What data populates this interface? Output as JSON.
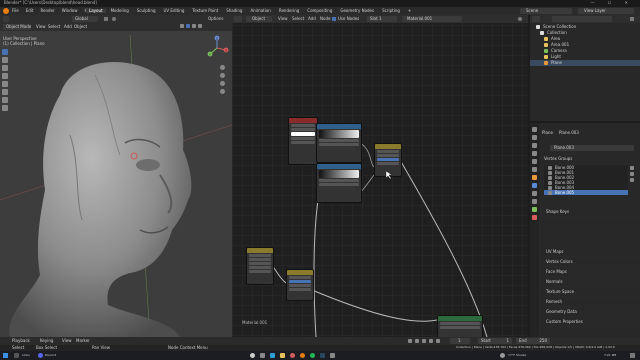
{
  "titlebar": {
    "title": "Blender* [C:\\Users\\Desktop\\blend\\head.blend]",
    "controls": [
      "—",
      "☐",
      "✕"
    ]
  },
  "menu": [
    "File",
    "Edit",
    "Render",
    "Window",
    "Help"
  ],
  "workspaces": [
    "Layout",
    "Modeling",
    "Sculpting",
    "UV Editing",
    "Texture Paint",
    "Shading",
    "Animation",
    "Rendering",
    "Compositing",
    "Geometry Nodes",
    "Scripting",
    "+"
  ],
  "active_workspace": "Layout",
  "scene": {
    "label": "Scene",
    "view_layer": "View Layer"
  },
  "viewport": {
    "transform": "Global",
    "options": "Options",
    "mode": "Object Mode",
    "menus": [
      "View",
      "Select",
      "Add",
      "Object"
    ],
    "info_line1": "User Perspective",
    "info_line2": "(1) Collection | Plane",
    "axes": [
      "Z",
      "X",
      "Y"
    ]
  },
  "node_editor": {
    "type": "Object",
    "menus": [
      "View",
      "Select",
      "Add",
      "Node"
    ],
    "use_nodes": "Use Nodes",
    "slot": "Slot 1",
    "material": "Material.001",
    "footer_label": "Material.001"
  },
  "outliner": {
    "title": "Scene Collection",
    "items": [
      {
        "name": "Collection",
        "icon": "collection-icon"
      },
      {
        "name": "Area",
        "icon": "light-icon"
      },
      {
        "name": "Area.001",
        "icon": "light-icon"
      },
      {
        "name": "Camera",
        "icon": "camera-icon"
      },
      {
        "name": "Light",
        "icon": "light-icon"
      },
      {
        "name": "Plane",
        "icon": "mesh-icon"
      }
    ]
  },
  "properties": {
    "object": "Plane",
    "data_name": "Plane.003",
    "mesh_field": "Plane.003",
    "vertex_groups_title": "Vertex Groups",
    "vertex_groups": [
      "Bone.000",
      "Bone.001",
      "Bone.002",
      "Bone.003",
      "Bone.004",
      "Bone.005"
    ],
    "shape_keys": "Shape Keys",
    "sections": [
      "UV Maps",
      "Vertex Colors",
      "Face Maps",
      "Normals",
      "Texture Space",
      "Remesh",
      "Geometry Data",
      "Custom Properties"
    ]
  },
  "timeline": {
    "menus": [
      "Playback",
      "Keying",
      "View",
      "Marker"
    ],
    "frame": "1",
    "start_label": "Start",
    "start": "1",
    "end_label": "End",
    "end": "250"
  },
  "statusbar": {
    "left": [
      "Select",
      "Box Select",
      "Pan View",
      "Node Context Menu"
    ],
    "right": "Collection | Plane | Verts:478,764 | Faces:478,464 | Tris:956,928 | Objects:1/5 | VRAM: 0.6/4.0 GiB | 2.93.0"
  },
  "taskbar": {
    "search": "Type here to search",
    "weather": "77°F Smoke",
    "time": "7:21 PM",
    "app_label": "Links",
    "app_label2": "Discord"
  },
  "colors": {
    "accent": "#4772b3",
    "red_header": "#8a2b2b",
    "blue_header": "#2f5f8a",
    "green_header": "#2e6a3e",
    "yellow_header": "#8a7a2b"
  }
}
